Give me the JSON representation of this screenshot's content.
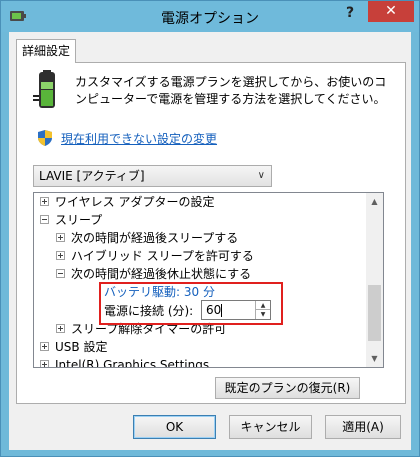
{
  "window": {
    "title": "電源オプション",
    "help_label": "?",
    "close_label": "✕"
  },
  "tab": {
    "label": "詳細設定"
  },
  "description": "カスタマイズする電源プランを選択してから、お使いのコンピューターで電源を管理する方法を選択してください。",
  "link": {
    "label": "現在利用できない設定の変更"
  },
  "plan_select": {
    "value": "LAVIE [アクティブ]",
    "chevron": "∨"
  },
  "tree": {
    "items": [
      {
        "label": "ワイヤレス アダプターの設定",
        "state": "plus"
      },
      {
        "label": "スリープ",
        "state": "minus"
      },
      {
        "label": "次の時間が経過後スリープする",
        "state": "plus"
      },
      {
        "label": "ハイブリッド スリープを許可する",
        "state": "plus"
      },
      {
        "label": "次の時間が経過後休止状態にする",
        "state": "minus"
      },
      {
        "label": "スリープ解除タイマーの許可",
        "state": "plus"
      },
      {
        "label": "USB 設定",
        "state": "plus"
      },
      {
        "label": "Intel(R) Graphics Settings",
        "state": "plus"
      }
    ],
    "battery_setting": {
      "label": "バッテリ駆動:",
      "value": "30 分"
    },
    "plugged_setting": {
      "label": "電源に接続 (分):",
      "value": "60"
    },
    "scroll_up": "▲",
    "scroll_down": "▼"
  },
  "buttons": {
    "restore": "既定のプランの復元(R)",
    "ok": "OK",
    "cancel": "キャンセル",
    "apply": "適用(A)"
  },
  "colors": {
    "titlebar": "#6fbadb",
    "close": "#c7403a",
    "link": "#1560bd",
    "highlight": "#e0201e"
  }
}
